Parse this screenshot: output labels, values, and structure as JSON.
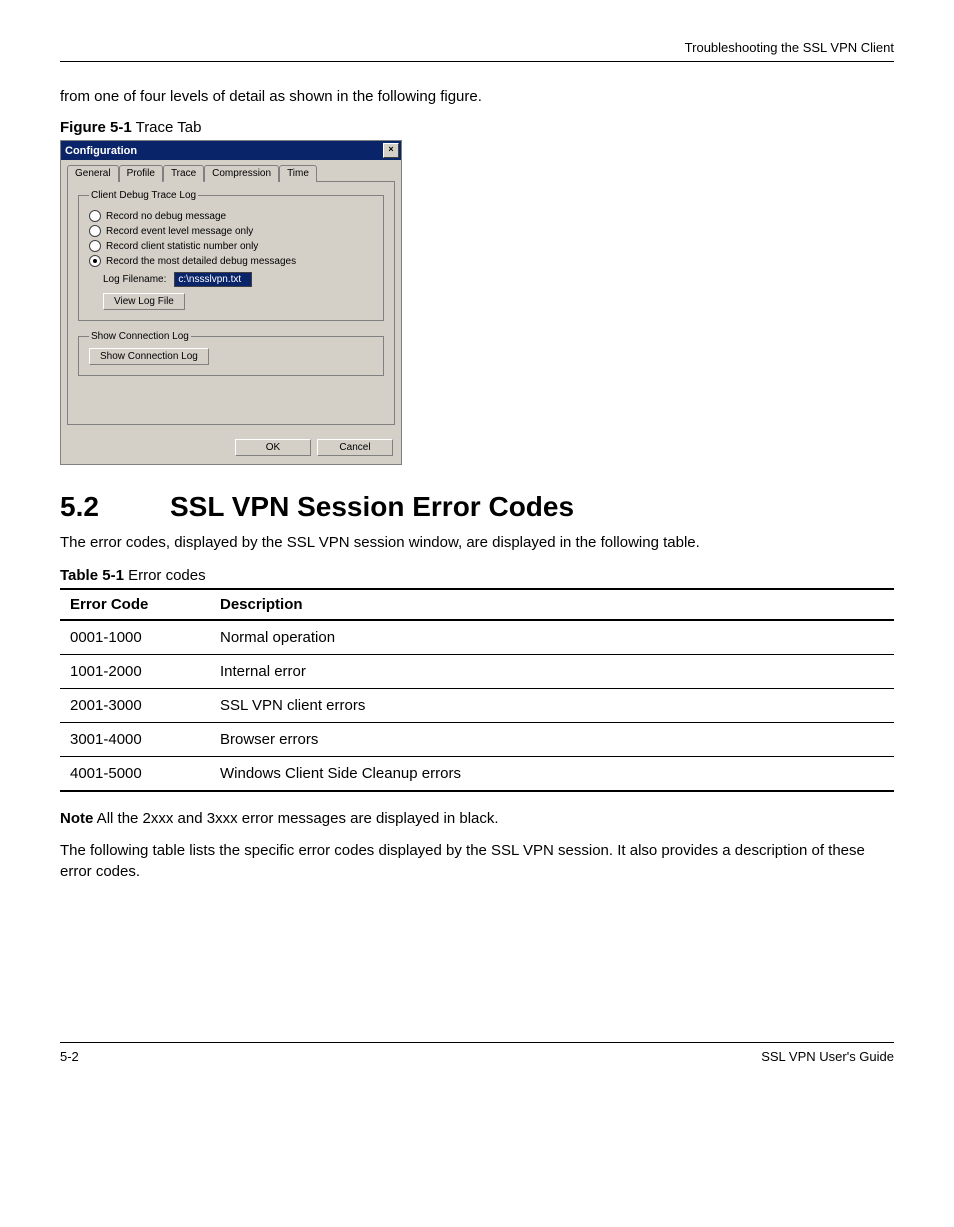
{
  "header": {
    "running_head": "Troubleshooting the SSL VPN Client"
  },
  "intro_text": "from one of four levels of detail as shown in the following figure.",
  "figure": {
    "label_bold": "Figure 5-1",
    "label_rest": "  Trace Tab"
  },
  "dialog": {
    "title": "Configuration",
    "close_glyph": "×",
    "tabs": {
      "general": "General",
      "profile": "Profile",
      "trace": "Trace",
      "compression": "Compression",
      "time": "Time"
    },
    "group1": {
      "legend": "Client Debug Trace Log",
      "opt_none": "Record no debug message",
      "opt_event": "Record event level message only",
      "opt_stats": "Record client statistic number only",
      "opt_detail": "Record the most detailed debug messages",
      "log_filename_label": "Log Filename:",
      "log_filename_value": "c:\\nssslvpn.txt",
      "view_log_btn": "View Log File"
    },
    "group2": {
      "legend": "Show Connection Log",
      "btn": "Show Connection Log"
    },
    "ok_btn": "OK",
    "cancel_btn": "Cancel"
  },
  "section": {
    "number": "5.2",
    "title": "SSL VPN Session Error Codes",
    "para1": "The error codes, displayed by the SSL VPN session window, are displayed in the following table."
  },
  "table": {
    "caption_bold": "Table 5-1",
    "caption_rest": "  Error codes",
    "col1": "Error Code",
    "col2": "Description",
    "rows": [
      {
        "code": "0001-1000",
        "desc": "Normal operation"
      },
      {
        "code": "1001-2000",
        "desc": "Internal error"
      },
      {
        "code": "2001-3000",
        "desc": "SSL VPN client errors"
      },
      {
        "code": "3001-4000",
        "desc": "Browser errors"
      },
      {
        "code": "4001-5000",
        "desc": "Windows Client Side Cleanup errors"
      }
    ]
  },
  "note": {
    "label": "Note",
    "text": " All the 2xxx and 3xxx error messages are displayed in black."
  },
  "para2": "The following table lists the specific error codes displayed by the SSL VPN session. It also provides a description of these error codes.",
  "footer": {
    "page": "5-2",
    "doc": "SSL VPN User's Guide"
  }
}
